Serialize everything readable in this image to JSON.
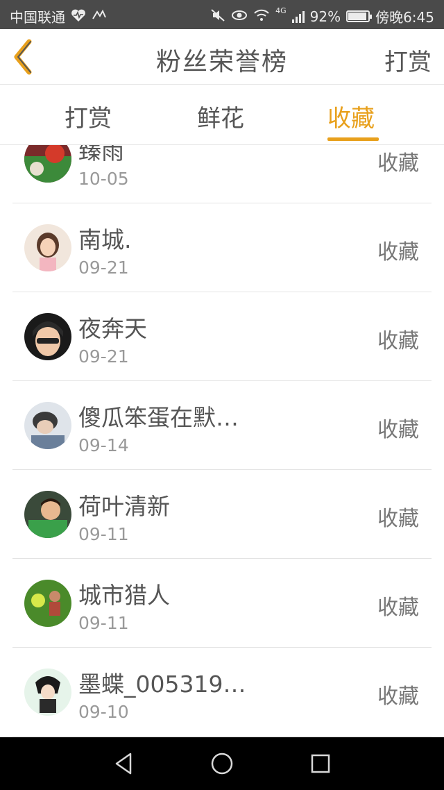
{
  "status_bar": {
    "carrier": "中国联通",
    "battery_percent": "92%",
    "time": "傍晚6:45",
    "network": "4G",
    "battery_level": 0.92
  },
  "header": {
    "title": "粉丝荣誉榜",
    "right_action": "打赏"
  },
  "tabs": [
    {
      "label": "打赏",
      "active": false
    },
    {
      "label": "鲜花",
      "active": false
    },
    {
      "label": "收藏",
      "active": true
    }
  ],
  "accent_color": "#e8a01c",
  "list": [
    {
      "name": "臻雨",
      "date": "10-05",
      "action": "收藏"
    },
    {
      "name": "南城.",
      "date": "09-21",
      "action": "收藏"
    },
    {
      "name": "夜奔天",
      "date": "09-21",
      "action": "收藏"
    },
    {
      "name": "傻瓜笨蛋在默…",
      "date": "09-14",
      "action": "收藏"
    },
    {
      "name": "荷叶清新",
      "date": "09-11",
      "action": "收藏"
    },
    {
      "name": "城市猎人",
      "date": "09-11",
      "action": "收藏"
    },
    {
      "name": "墨蝶_005319…",
      "date": "09-10",
      "action": "收藏"
    }
  ]
}
